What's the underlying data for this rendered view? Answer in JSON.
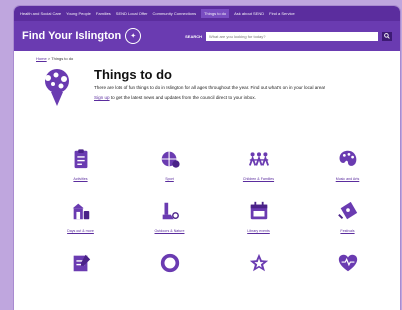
{
  "colors": {
    "brand": "#5b2d9e",
    "brand_light": "#6a3bb1",
    "page_bg": "#bfa6de"
  },
  "topnav": {
    "items": [
      {
        "label": "Health and Social Care"
      },
      {
        "label": "Young People"
      },
      {
        "label": "Families"
      },
      {
        "label": "SEND Local Offer"
      },
      {
        "label": "Community Connections"
      },
      {
        "label": "Things to do"
      },
      {
        "label": "Ask about SEND"
      },
      {
        "label": "Find a Service"
      }
    ]
  },
  "header": {
    "brand": "Find Your Islington",
    "search_label": "SEARCH",
    "search_placeholder": "What are you looking for today?"
  },
  "breadcrumb": {
    "home": "Home",
    "separator": ">",
    "current": "Things to do"
  },
  "hero": {
    "title": "Things to do",
    "intro": "There are lots of fun things to do in Islington for all ages throughout the year. Find out what's on in your local area!",
    "signup_link": "Sign up",
    "signup_text": "to get the latest news and updates from the council direct to your inbox."
  },
  "categories": [
    {
      "label": "Activities",
      "icon": "clipboard-icon"
    },
    {
      "label": "Sport",
      "icon": "sports-icon"
    },
    {
      "label": "Children & Families",
      "icon": "family-icon"
    },
    {
      "label": "Music and Arts",
      "icon": "palette-icon"
    },
    {
      "label": "Days out & more",
      "icon": "building-icon"
    },
    {
      "label": "Outdoors & Nature",
      "icon": "explore-icon"
    },
    {
      "label": "Library events",
      "icon": "calendar-icon"
    },
    {
      "label": "Festivals",
      "icon": "ticket-icon"
    },
    {
      "label": "",
      "icon": "notepad-icon"
    },
    {
      "label": "",
      "icon": "ring-icon"
    },
    {
      "label": "",
      "icon": "star-icon"
    },
    {
      "label": "",
      "icon": "heart-icon"
    }
  ]
}
